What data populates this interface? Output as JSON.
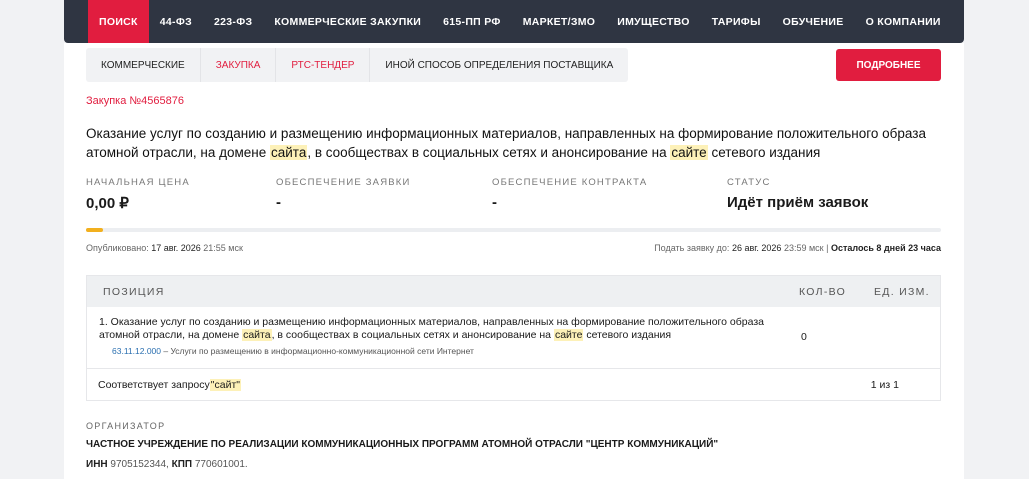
{
  "nav": [
    "ПОИСК",
    "44-ФЗ",
    "223-ФЗ",
    "КОММЕРЧЕСКИЕ ЗАКУПКИ",
    "615-ПП РФ",
    "МАРКЕТ/ЗМО",
    "ИМУЩЕСТВО",
    "ТАРИФЫ",
    "ОБУЧЕНИЕ",
    "О КОМПАНИИ"
  ],
  "tabs": [
    "КОММЕРЧЕСКИЕ",
    "ЗАКУПКА",
    "РТС-ТЕНДЕР",
    "ИНОЙ СПОСОБ ОПРЕДЕЛЕНИЯ ПОСТАВЩИКА"
  ],
  "more_button": "ПОДРОБНЕЕ",
  "purchase_number": "Закупка №4565876",
  "title": {
    "p1": "Оказание услуг по созданию и размещению информационных материалов, направленных на формирование положительного образа атомной отрасли, на домене ",
    "h1": "сайта",
    "p2": ", в сообществах в социальных сетях и анонсирование на ",
    "h2": "сайте",
    "p3": " сетевого издания"
  },
  "stats": [
    {
      "label": "НАЧАЛЬНАЯ ЦЕНА",
      "value": "0,00 ₽"
    },
    {
      "label": "ОБЕСПЕЧЕНИЕ ЗАЯВКИ",
      "value": "-"
    },
    {
      "label": "ОБЕСПЕЧЕНИЕ КОНТРАКТА",
      "value": "-"
    },
    {
      "label": "СТАТУС",
      "value": "Идёт приём заявок"
    }
  ],
  "progress_fraction": 0.02,
  "published": {
    "label": "Опубликовано:",
    "date": "17 авг. 2026",
    "time": "21:55 мск"
  },
  "deadline": {
    "label": "Подать заявку до:",
    "date": "26 авг. 2026",
    "time": "23:59 мск",
    "sep": "|",
    "remaining": "Осталось 8 дней 23 часа"
  },
  "table": {
    "headers": [
      "ПОЗИЦИЯ",
      "КОЛ-ВО",
      "ЕД. ИЗМ."
    ],
    "row": {
      "p1": "1. Оказание услуг по созданию и размещению информационных материалов, направленных на формирование положительного образа атомной отрасли, на домене ",
      "h1": "сайта",
      "p2": ", в сообществах в социальных сетях и анонсирование на ",
      "h2": "сайте",
      "p3": " сетевого издания",
      "code": "63.11.12.000",
      "code_desc": " – Услуги по размещению в информационно-коммуникационной сети Интернет",
      "qty": "0"
    },
    "match_label": "Соответствует запросу ",
    "match_query": "\"сайт\"",
    "match_count": "1 из 1"
  },
  "organizer": {
    "label": "ОРГАНИЗАТОР",
    "name": "ЧАСТНОЕ УЧРЕЖДЕНИЕ ПО РЕАЛИЗАЦИИ КОММУНИКАЦИОННЫХ ПРОГРАММ АТОМНОЙ ОТРАСЛИ \"ЦЕНТР КОММУНИКАЦИЙ\"",
    "inn_label": "ИНН",
    "inn": " 9705152344,",
    "kpp_label": "КПП",
    "kpp": " 770601001."
  }
}
